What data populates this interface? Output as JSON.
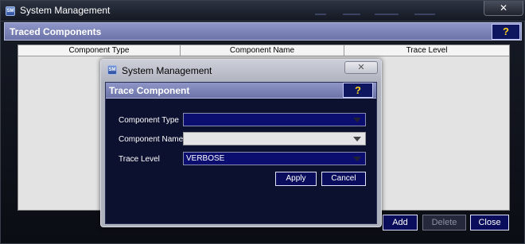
{
  "window": {
    "title": "System Management",
    "close_glyph": "✕",
    "app_icon_text": "SM"
  },
  "traced": {
    "section_title": "Traced Components",
    "help_label": "?",
    "columns": [
      "Component Type",
      "Component Name",
      "Trace Level"
    ],
    "rows": []
  },
  "footer": {
    "add_label": "Add",
    "delete_label": "Delete",
    "close_label": "Close"
  },
  "dialog": {
    "title": "System Management",
    "close_glyph": "✕",
    "section_title": "Trace Component",
    "help_label": "?",
    "fields": {
      "component_type": {
        "label": "Component Type",
        "value": ""
      },
      "component_name": {
        "label": "Component Name",
        "value": ""
      },
      "trace_level": {
        "label": "Trace Level",
        "value": "VERBOSE"
      }
    },
    "apply_label": "Apply",
    "cancel_label": "Cancel"
  },
  "colors": {
    "section_bar": "#7b83b8",
    "button_navy": "#0a0d5c",
    "help_yellow": "#ffd21e"
  }
}
